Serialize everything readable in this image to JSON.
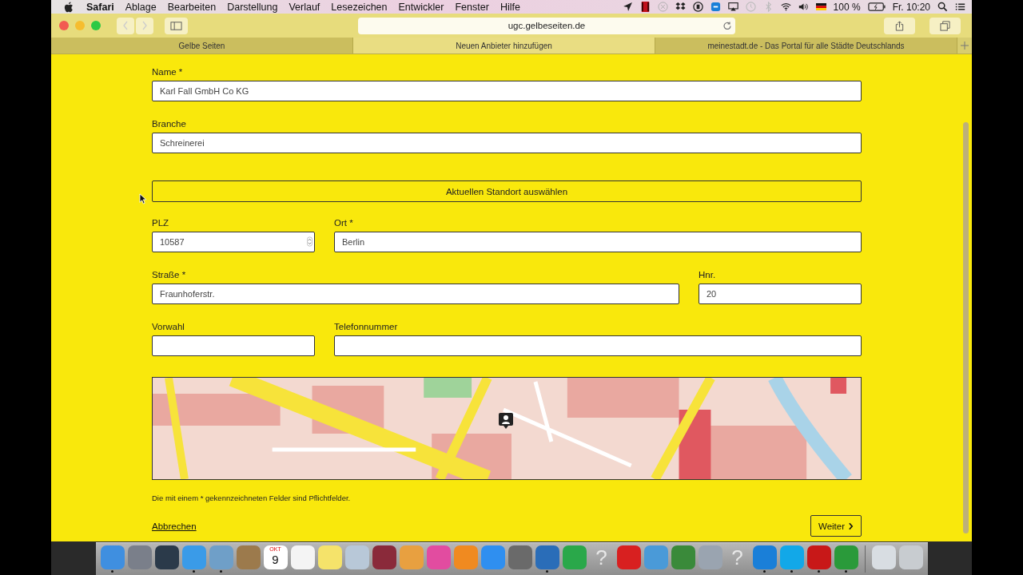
{
  "menubar": {
    "menus": [
      {
        "label": "Safari",
        "kind": "app"
      },
      {
        "label": "Ablage",
        "kind": "menu"
      },
      {
        "label": "Bearbeiten",
        "kind": "menu"
      },
      {
        "label": "Darstellung",
        "kind": "menu"
      },
      {
        "label": "Verlauf",
        "kind": "menu"
      },
      {
        "label": "Lesezeichen",
        "kind": "menu"
      },
      {
        "label": "Entwickler",
        "kind": "menu"
      },
      {
        "label": "Fenster",
        "kind": "menu"
      },
      {
        "label": "Hilfe",
        "kind": "menu"
      }
    ],
    "battery": "100 %",
    "clock": "Fr. 10:20"
  },
  "toolbar": {
    "url": "ugc.gelbeseiten.de"
  },
  "tabs": [
    {
      "label": "Gelbe Seiten",
      "selected": false
    },
    {
      "label": "Neuen Anbieter hinzufügen",
      "selected": true
    },
    {
      "label": "meinestadt.de - Das Portal für alle Städte Deutschlands",
      "selected": false
    }
  ],
  "form": {
    "rows": [
      [
        {
          "kind": "text",
          "label": "Name *",
          "value": "Karl Fall GmbH Co KG"
        }
      ],
      [
        {
          "kind": "text",
          "label": "Branche",
          "value": "Schreinerei"
        }
      ],
      [
        {
          "kind": "button",
          "label": "Aktuellen Standort auswählen"
        }
      ],
      [
        {
          "kind": "number",
          "label": "PLZ",
          "value": "10587"
        },
        {
          "kind": "text",
          "label": "Ort *",
          "value": "Berlin"
        }
      ],
      [
        {
          "kind": "text",
          "label": "Straße *",
          "value": "Fraunhoferstr."
        },
        {
          "kind": "text",
          "label": "Hnr.",
          "value": "20"
        }
      ],
      [
        {
          "kind": "text",
          "label": "Vorwahl"
        },
        {
          "kind": "text",
          "label": "Telefonnummer"
        }
      ]
    ],
    "map": {
      "kind": "picture"
    },
    "note": "Die mit einem * gekennzeichneten Felder sind Pflichtfelder.",
    "cancel": "Abbrechen",
    "next": "Weiter"
  },
  "dock": [
    {
      "kind": "tile",
      "color": "#3f8fe0",
      "running": true
    },
    {
      "kind": "tile",
      "color": "#7a7f8a",
      "running": false
    },
    {
      "kind": "tile",
      "color": "#2b3a4a",
      "running": false
    },
    {
      "kind": "tile",
      "color": "#3a9be8",
      "running": true
    },
    {
      "kind": "tile",
      "color": "#6f9fc8",
      "running": true
    },
    {
      "kind": "tile",
      "color": "#9c7a4c",
      "running": false
    },
    {
      "kind": "calendar",
      "month": "OKT",
      "day": "9",
      "running": false
    },
    {
      "kind": "tile",
      "color": "#f4f4f4",
      "running": false
    },
    {
      "kind": "tile",
      "color": "#f5e36a",
      "running": false
    },
    {
      "kind": "tile",
      "color": "#b8c8d8",
      "running": false
    },
    {
      "kind": "tile",
      "color": "#8a2a3a",
      "running": false
    },
    {
      "kind": "tile",
      "color": "#e8a040",
      "running": false
    },
    {
      "kind": "tile",
      "color": "#e24ca0",
      "running": false
    },
    {
      "kind": "tile",
      "color": "#f08a20",
      "running": false
    },
    {
      "kind": "tile",
      "color": "#2f8ff0",
      "running": false
    },
    {
      "kind": "tile",
      "color": "#6a6a6a",
      "running": false
    },
    {
      "kind": "tile",
      "color": "#2a6db8",
      "running": true
    },
    {
      "kind": "tile",
      "color": "#2aa84a",
      "running": false
    },
    {
      "kind": "question",
      "glyph": "?",
      "running": false
    },
    {
      "kind": "tile",
      "color": "#d82020",
      "running": false
    },
    {
      "kind": "tile",
      "color": "#4a9ad8",
      "running": false
    },
    {
      "kind": "tile",
      "color": "#3a8a3a",
      "running": false
    },
    {
      "kind": "tile",
      "color": "#9aa4b0",
      "running": false
    },
    {
      "kind": "question",
      "glyph": "?",
      "running": false
    },
    {
      "kind": "tile",
      "color": "#1a7fd8",
      "running": true
    },
    {
      "kind": "tile",
      "color": "#12a8e8",
      "running": true
    },
    {
      "kind": "tile",
      "color": "#c81818",
      "running": true
    },
    {
      "kind": "tile",
      "color": "#2a9a3a",
      "running": true
    },
    {
      "kind": "separator"
    },
    {
      "kind": "tile",
      "color": "#d8dde2",
      "running": false
    },
    {
      "kind": "tile",
      "color": "#c8ccd0",
      "running": false
    }
  ]
}
